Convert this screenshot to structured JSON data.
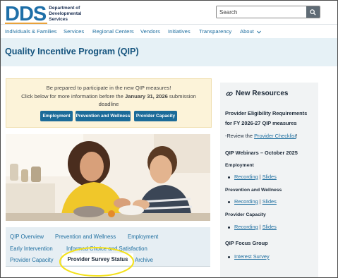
{
  "header": {
    "logo_mark": "DDS",
    "logo_text_lines": [
      "Department of",
      "Developmental",
      "Services"
    ],
    "search_placeholder": "Search"
  },
  "nav": {
    "items": [
      "Individuals & Families",
      "Services",
      "Regional Centers",
      "Vendors",
      "Initiatives",
      "Transparency",
      "About"
    ]
  },
  "page": {
    "title": "Quality Incentive Program (QIP)"
  },
  "notice": {
    "line1": "Be prepared to participate in the new QIP measures!",
    "line2_pre": "Click below for more information before the ",
    "line2_bold": "January 31, 2026",
    "line2_post": " submission",
    "line3": "deadline",
    "buttons": [
      "Employment",
      "Prevention and Wellness",
      "Provider Capacity"
    ]
  },
  "tabs": {
    "row1": [
      "QIP Overview",
      "Prevention and Wellness",
      "Employment"
    ],
    "row2": [
      "Early Intervention",
      "Informed Choice and Satisfaction"
    ],
    "row3_left": "Provider Capacity",
    "active": "Provider Survey Status",
    "row3_right": "Archive"
  },
  "sidebar": {
    "title": "New Resources",
    "req_line1": "Provider Eligibility Requirements",
    "req_line2": "for FY 2026-27 QIP measures",
    "review_pre": "-Review the ",
    "review_link": "Provider Checklist",
    "review_post": "!",
    "webinars_title": "QIP Webinars – October 2025",
    "sections": [
      {
        "label": "Employment",
        "links": [
          "Recording",
          "Slides"
        ]
      },
      {
        "label": "Prevention and Wellness",
        "links": [
          "Recording",
          "Slides"
        ]
      },
      {
        "label": "Provider Capacity",
        "links": [
          "Recording",
          "Slides"
        ]
      }
    ],
    "separator": "|",
    "focus_title": "QIP Focus Group",
    "focus_link": "Interest Survey"
  },
  "colors": {
    "brand": "#1e6fa8",
    "nav_link": "#1f6fa0",
    "title": "#15547e",
    "button": "#1b6b99",
    "notice_bg": "#fcf3d9",
    "highlight": "#f4e11a"
  }
}
